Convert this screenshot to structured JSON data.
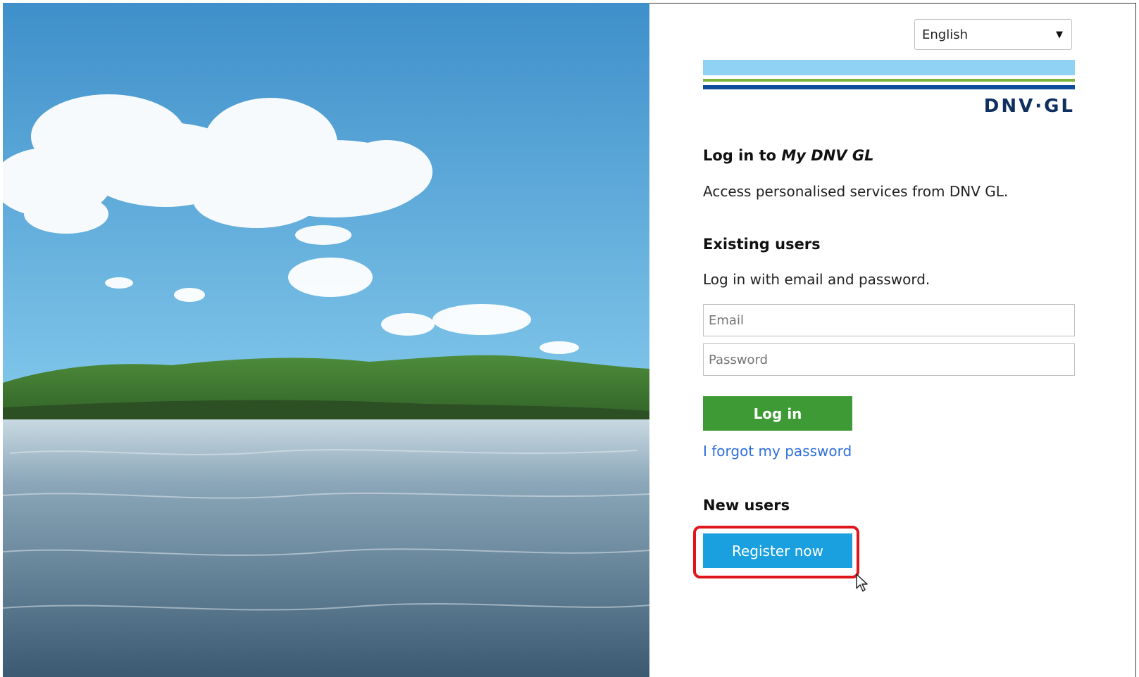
{
  "language_select": {
    "value": "English"
  },
  "logo": {
    "text": "DNV·GL",
    "colors": {
      "light_blue": "#8fd2f3",
      "green": "#7bb33a",
      "dark_blue": "#0f4c9b"
    }
  },
  "intro": {
    "title_prefix": "Log in to",
    "title_brand": "My DNV GL",
    "subtitle": "Access personalised services from DNV GL."
  },
  "existing_users": {
    "heading": "Existing users",
    "description": "Log in with email and password.",
    "email_placeholder": "Email",
    "password_placeholder": "Password",
    "login_label": "Log in",
    "forgot_label": "I forgot my password"
  },
  "new_users": {
    "heading": "New users",
    "register_label": "Register now"
  },
  "colors": {
    "login_button": "#3d9a34",
    "register_button": "#1aa0df",
    "highlight": "#e0161c",
    "link": "#2f6fdb"
  }
}
